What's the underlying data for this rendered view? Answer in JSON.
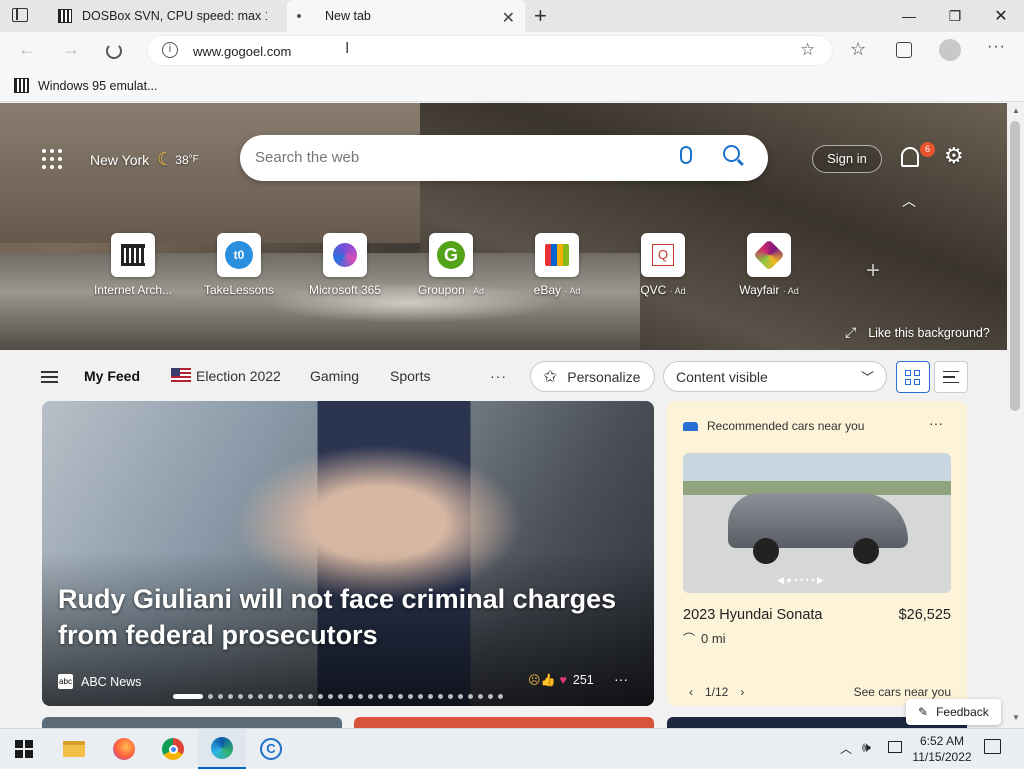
{
  "tabs": [
    {
      "title": "DOSBox SVN, CPU speed: max 1!",
      "active": false
    },
    {
      "title": "New tab",
      "active": true
    }
  ],
  "address": {
    "url": "www.gogoel.com"
  },
  "favorites": [
    {
      "label": "Windows 95 emulat..."
    }
  ],
  "hero": {
    "location": "New York",
    "temperature": "38",
    "unit": "°F",
    "search_placeholder": "Search the web",
    "sign_in": "Sign in",
    "notification_count": "6",
    "like_background": "Like this background?"
  },
  "quicklinks": [
    {
      "label": "Internet Arch...",
      "ad": ""
    },
    {
      "label": "TakeLessons",
      "ad": ""
    },
    {
      "label": "Microsoft 365",
      "ad": ""
    },
    {
      "label": "Groupon",
      "ad": "· Ad"
    },
    {
      "label": "eBay",
      "ad": "· Ad"
    },
    {
      "label": "QVC",
      "ad": "· Ad"
    },
    {
      "label": "Wayfair",
      "ad": "· Ad"
    }
  ],
  "feed": {
    "tabs": [
      "My Feed",
      "Election 2022",
      "Gaming",
      "Sports"
    ],
    "personalize": "Personalize",
    "content_visible": "Content visible"
  },
  "main_story": {
    "headline": "Rudy Giuliani will not face criminal charges from federal prosecutors",
    "source": "ABC News",
    "reactions": "251"
  },
  "car_card": {
    "header": "Recommended cars near you",
    "model": "2023 Hyundai Sonata",
    "price": "$26,525",
    "mileage": "0 mi",
    "pager": "1/12",
    "see_cars": "See cars near you"
  },
  "feedback": "Feedback",
  "taskbar": {
    "time": "6:52 AM",
    "date": "11/15/2022"
  }
}
